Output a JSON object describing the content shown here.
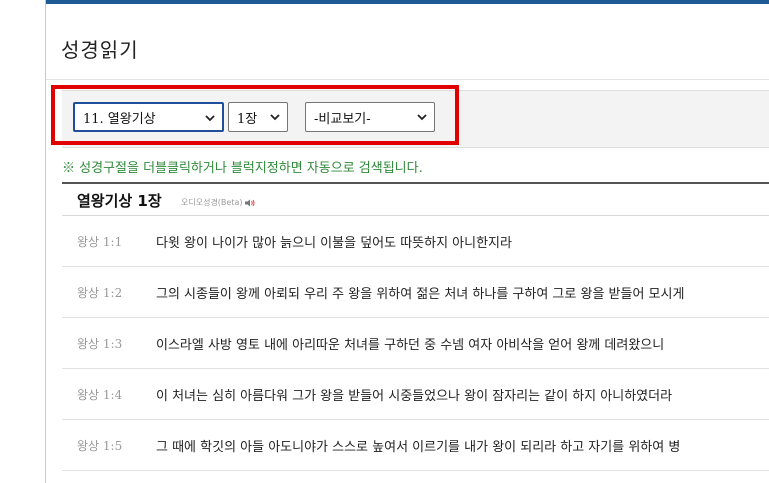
{
  "page": {
    "title": "성경읽기"
  },
  "selectors": {
    "book": "11. 열왕기상",
    "chapter": "1장",
    "compare": "-비교보기-"
  },
  "notice": "※ 성경구절을 더블클릭하거나 블럭지정하면 자동으로 검색됩니다.",
  "chapter_header": {
    "title": "열왕기상 1장",
    "audio_label": "오디오성경(Beta)"
  },
  "verses": [
    {
      "ref": "왕상 1:1",
      "text": "다윗 왕이 나이가 많아 늙으니 이불을 덮어도 따뜻하지 아니한지라"
    },
    {
      "ref": "왕상 1:2",
      "text": "그의 시종들이 왕께 아뢰되 우리 주 왕을 위하여 젊은 처녀 하나를 구하여 그로 왕을 받들어 모시게"
    },
    {
      "ref": "왕상 1:3",
      "text": "이스라엘 사방 영토 내에 아리따운 처녀를 구하던 중 수넴 여자 아비삭을 얻어 왕께 데려왔으니"
    },
    {
      "ref": "왕상 1:4",
      "text": "이 처녀는 심히 아름다워 그가 왕을 받들어 시중들었으나 왕이 잠자리는 같이 하지 아니하였더라"
    },
    {
      "ref": "왕상 1:5",
      "text": "그 때에 학깃의 아들 아도니야가 스스로 높여서 이르기를 내가 왕이 되리라 하고 자기를 위하여 병"
    }
  ],
  "colors": {
    "top_bar": "#1f5a96",
    "highlight": "#e00000",
    "notice": "#2f8a3a",
    "verse_ref": "#9a9a9a"
  },
  "icons": {
    "dropdown": "chevron-down-icon",
    "audio": "speaker-icon"
  }
}
